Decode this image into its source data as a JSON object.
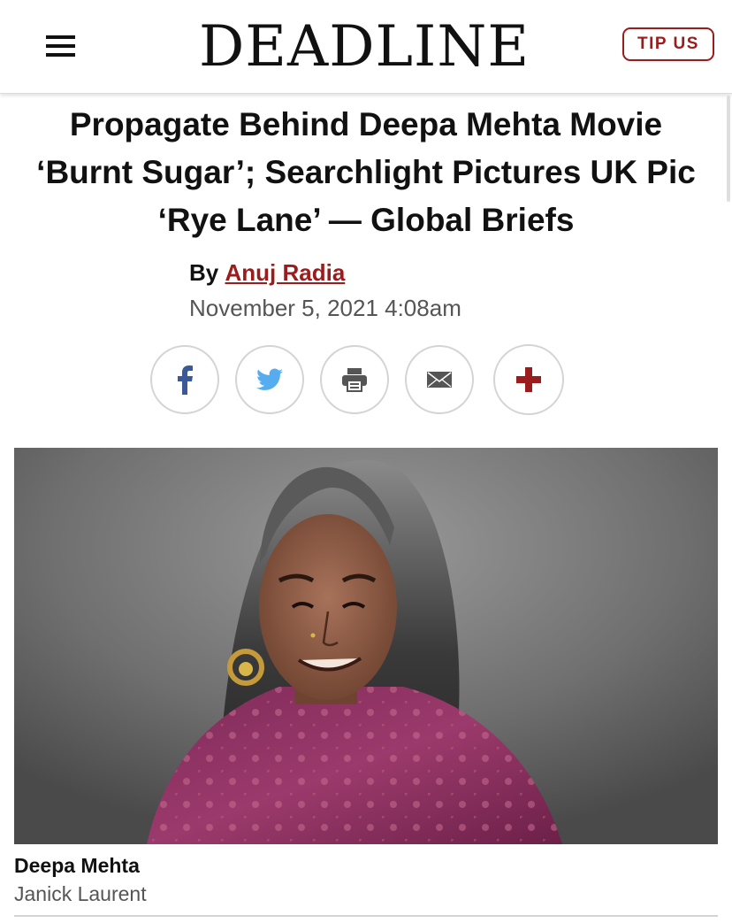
{
  "header": {
    "logo": "DEADLINE",
    "tip_label": "TIP US"
  },
  "article": {
    "headline": "Propagate Behind Deepa Mehta Movie ‘Burnt Sugar’; Searchlight Pictures UK Pic ‘Rye Lane’ — Global Briefs",
    "byline_prefix": "By",
    "author": "Anuj Radia",
    "date": "November 5, 2021 4:08am"
  },
  "share": {
    "icons": [
      "facebook-icon",
      "twitter-icon",
      "print-icon",
      "email-icon",
      "plus-icon"
    ]
  },
  "image": {
    "caption_title": "Deepa Mehta",
    "caption_credit": "Janick Laurent"
  },
  "colors": {
    "accent": "#9b1c1c",
    "facebook": "#3b5998",
    "twitter": "#55acee",
    "icon_gray": "#555555"
  }
}
